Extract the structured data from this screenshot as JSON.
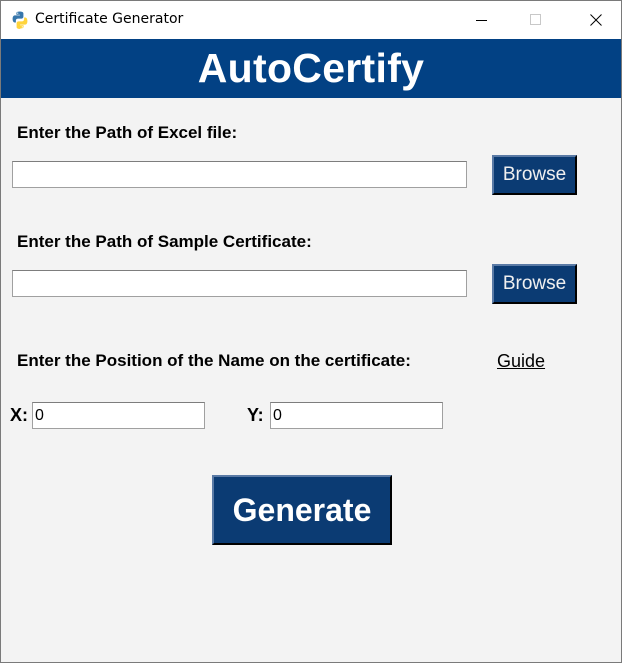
{
  "window": {
    "title": "Certificate Generator"
  },
  "banner": {
    "title": "AutoCertify"
  },
  "excel": {
    "label": "Enter the Path of Excel file:",
    "value": "",
    "browse_label": "Browse"
  },
  "certificate": {
    "label": "Enter the Path of Sample Certificate:",
    "value": "",
    "browse_label": "Browse"
  },
  "position": {
    "label": "Enter the Position of the Name on the certificate:",
    "guide_label": "Guide",
    "x_label": "X:",
    "x_value": "0",
    "y_label": "Y:",
    "y_value": "0"
  },
  "generate_label": "Generate",
  "colors": {
    "banner": "#024184",
    "button": "#0b3b73",
    "background": "#f3f3f3"
  },
  "icons": {
    "app": "python-icon",
    "minimize": "minimize-icon",
    "maximize": "maximize-icon",
    "close": "close-icon"
  }
}
